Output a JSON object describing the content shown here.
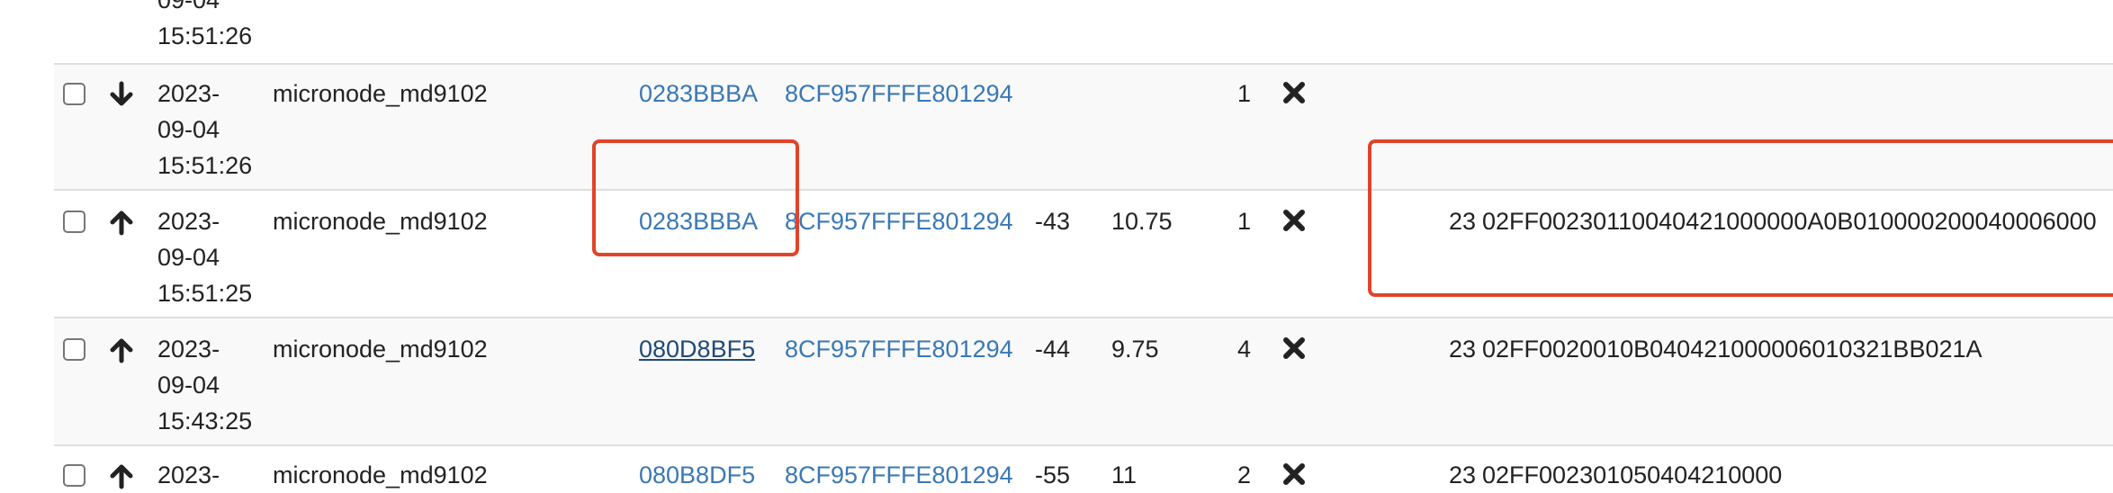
{
  "top_partial": {
    "time_fragment": "09-04",
    "time": "15:51:26"
  },
  "rows": [
    {
      "date1": "2023-",
      "date2": "09-04",
      "time": "15:51:26",
      "direction": "down",
      "device": "micronode_md9102",
      "dev_addr": "0283BBBA",
      "gateway": "8CF957FFFE801294",
      "rssi": "",
      "snr": "",
      "count": "1",
      "status_icon": "x-icon",
      "port": "",
      "payload": ""
    },
    {
      "date1": "2023-",
      "date2": "09-04",
      "time": "15:51:25",
      "direction": "up",
      "device": "micronode_md9102",
      "dev_addr": "0283BBBA",
      "gateway": "8CF957FFFE801294",
      "rssi": "-43",
      "snr": "10.75",
      "count": "1",
      "status_icon": "x-icon",
      "port": "23",
      "payload": "02FF00230110040421000000A0B010000200040006000"
    },
    {
      "date1": "2023-",
      "date2": "09-04",
      "time": "15:43:25",
      "direction": "up",
      "device": "micronode_md9102",
      "dev_addr": "080D8BF5",
      "gateway": "8CF957FFFE801294",
      "rssi": "-44",
      "snr": "9.75",
      "count": "4",
      "status_icon": "x-icon",
      "port": "23",
      "payload": "02FF0020010B040421000006010321BB021A"
    },
    {
      "date1": "2023-",
      "date2": "",
      "time": "",
      "direction": "up",
      "device": "micronode_md9102",
      "dev_addr": "080B8DF5",
      "gateway": "8CF957FFFE801294",
      "rssi": "-55",
      "snr": "11",
      "count": "2",
      "status_icon": "x-icon",
      "port": "23",
      "payload": "02FF002301050404210000"
    }
  ],
  "colors": {
    "link": "#3a78b4",
    "link_visited": "#1f4a78",
    "highlight": "#e0432a",
    "zebra": "#f9f9f9",
    "border": "#dedede"
  }
}
